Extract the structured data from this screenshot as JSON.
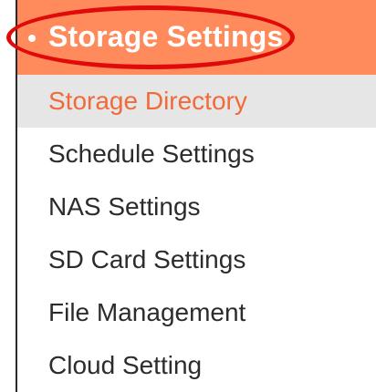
{
  "menu": {
    "header": {
      "title": "Storage Settings",
      "bullet_icon": "bullet-icon",
      "background_color": "#ff8a5b",
      "annotation_color": "#e10a0a"
    },
    "items": [
      {
        "label": "Storage Directory",
        "active": true
      },
      {
        "label": "Schedule Settings",
        "active": false
      },
      {
        "label": "NAS Settings",
        "active": false
      },
      {
        "label": "SD Card Settings",
        "active": false
      },
      {
        "label": "File Management",
        "active": false
      },
      {
        "label": "Cloud Setting",
        "active": false
      }
    ],
    "active_color": "#f26a3a",
    "active_background": "#e6e6e6"
  }
}
